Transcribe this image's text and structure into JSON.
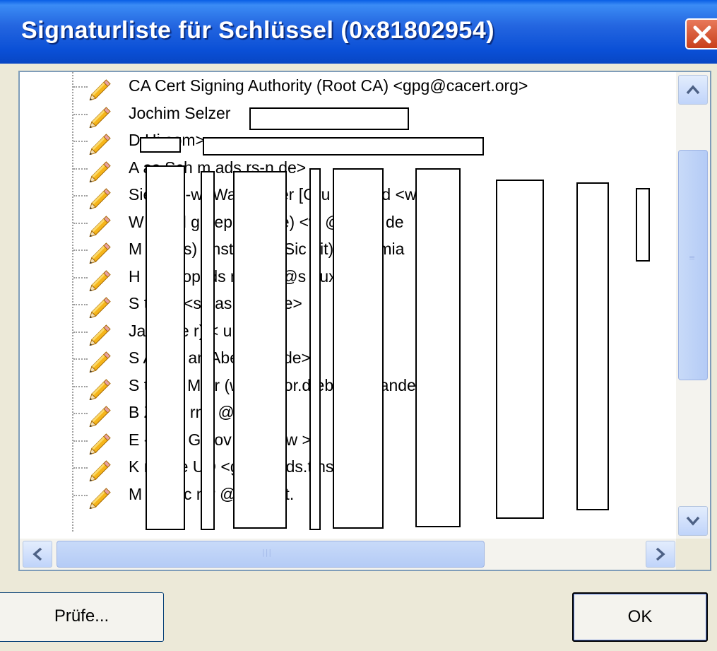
{
  "window": {
    "title": "Signaturliste für Schlüssel (0x81802954)"
  },
  "signatures": [
    "CA Cert Signing Authority (Root CA) <gpg@cacert.org>",
    "Jochim Selzer",
    "D    Hi                                com>",
    "A    as Sch     m  ads    rs-n    de>",
    "Sie     e.V   -w     (Walte    elder     [Gru       ngs     lied    <w",
    "W    Gield     g (    epo     telpl     e) <w     @fri     pla    de",
    "M     S   iat     s) -  nst    ur In     t Sic    eit) <     co.   mia",
    "H     P   pp      op   lds     ne) <     d@s     nux.",
    "S    tia   In      <s   bas     @in     .de>",
    "Ja    H   ufe      r) <   ur5    ur5r.",
    "S    A   elm     an  Abe     @t-o     de>",
    "S    tia   va      Me  r (w     kerr     ror.d     ebas     @vande",
    "B    Zeme     rnd   @b     de>",
    "E    -Serg     Go   ov     gen     ie-w     >",
    "K    na Ge     UD   <g     k.fv.     nds.t     nsta     e>",
    "M    s Reic    mr   @ma     helt."
  ],
  "buttons": {
    "check": "Prüfe...",
    "ok": "OK"
  },
  "icons": {
    "signature": "pencil-icon",
    "close": "close-icon",
    "scroll_up": "arrow-up-icon",
    "scroll_down": "arrow-down-icon",
    "scroll_left": "arrow-left-icon",
    "scroll_right": "arrow-right-icon"
  },
  "colors": {
    "titlebar": "#0a4fd6",
    "close": "#c8401c",
    "dialog_bg": "#ece9d8"
  }
}
